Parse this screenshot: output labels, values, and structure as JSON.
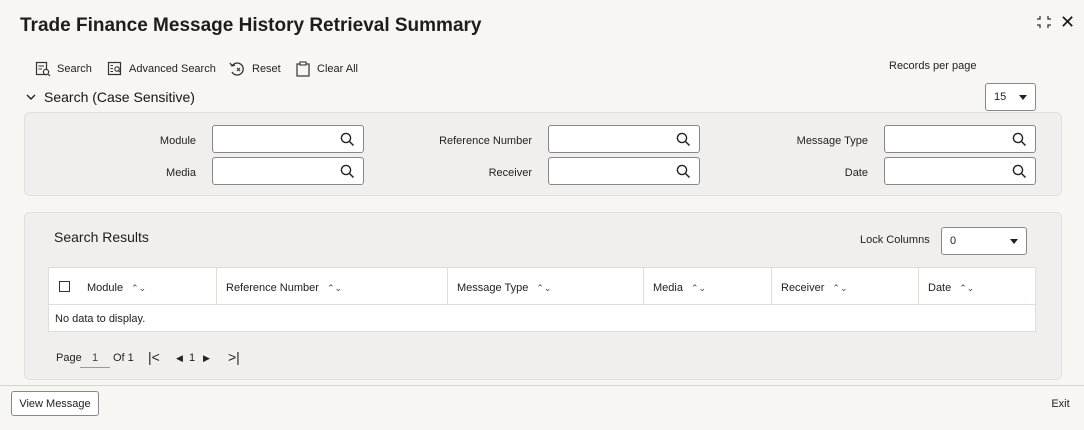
{
  "window": {
    "title": "Trade Finance Message History Retrieval Summary",
    "close_glyph": "✕"
  },
  "toolbar": {
    "search": "Search",
    "advanced_search": "Advanced Search",
    "reset": "Reset",
    "clear_all": "Clear All",
    "records_per_page_label": "Records per page",
    "records_per_page_value": "15"
  },
  "search_section": {
    "title": "Search (Case Sensitive)",
    "fields": {
      "module": "Module",
      "reference_number": "Reference Number",
      "message_type": "Message Type",
      "media": "Media",
      "receiver": "Receiver",
      "date": "Date"
    }
  },
  "results": {
    "title": "Search Results",
    "lock_columns_label": "Lock Columns",
    "lock_columns_value": "0",
    "columns": [
      "Module",
      "Reference Number",
      "Message Type",
      "Media",
      "Receiver",
      "Date"
    ],
    "empty_text": "No data to display.",
    "pager": {
      "page_label": "Page",
      "page_value": "1",
      "of_label": "Of 1",
      "current": "1"
    }
  },
  "footer": {
    "view_message": "View Message",
    "exit": "Exit"
  }
}
